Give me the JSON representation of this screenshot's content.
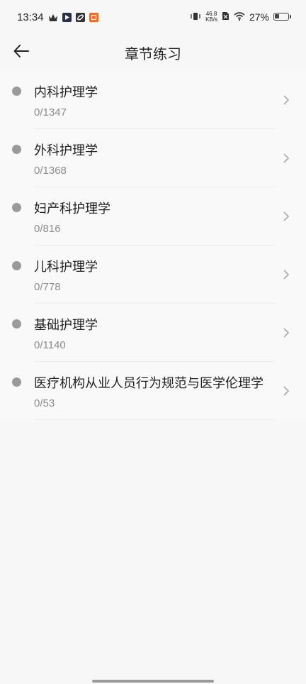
{
  "status_bar": {
    "time": "13:34",
    "net_speed_value": "46.8",
    "net_speed_unit": "KB/s",
    "battery_percent": "27%",
    "icons": [
      "crown-icon",
      "play-app-icon",
      "link-app-icon",
      "orange-app-icon",
      "vibrate-icon",
      "sim-off-icon",
      "wifi-icon",
      "battery-icon"
    ]
  },
  "header": {
    "title": "章节练习",
    "back_icon": "arrow-left-icon"
  },
  "chapters": [
    {
      "name": "内科护理学",
      "progress": "0/1347"
    },
    {
      "name": "外科护理学",
      "progress": "0/1368"
    },
    {
      "name": "妇产科护理学",
      "progress": "0/816"
    },
    {
      "name": "儿科护理学",
      "progress": "0/778"
    },
    {
      "name": "基础护理学",
      "progress": "0/1140"
    },
    {
      "name": "医疗机构从业人员行为规范与医学伦理学",
      "progress": "0/53"
    }
  ],
  "colors": {
    "background": "#f7f7f7",
    "dot": "#9a9a9a",
    "title_text": "#222222",
    "progress_text": "#8c8c8c"
  }
}
